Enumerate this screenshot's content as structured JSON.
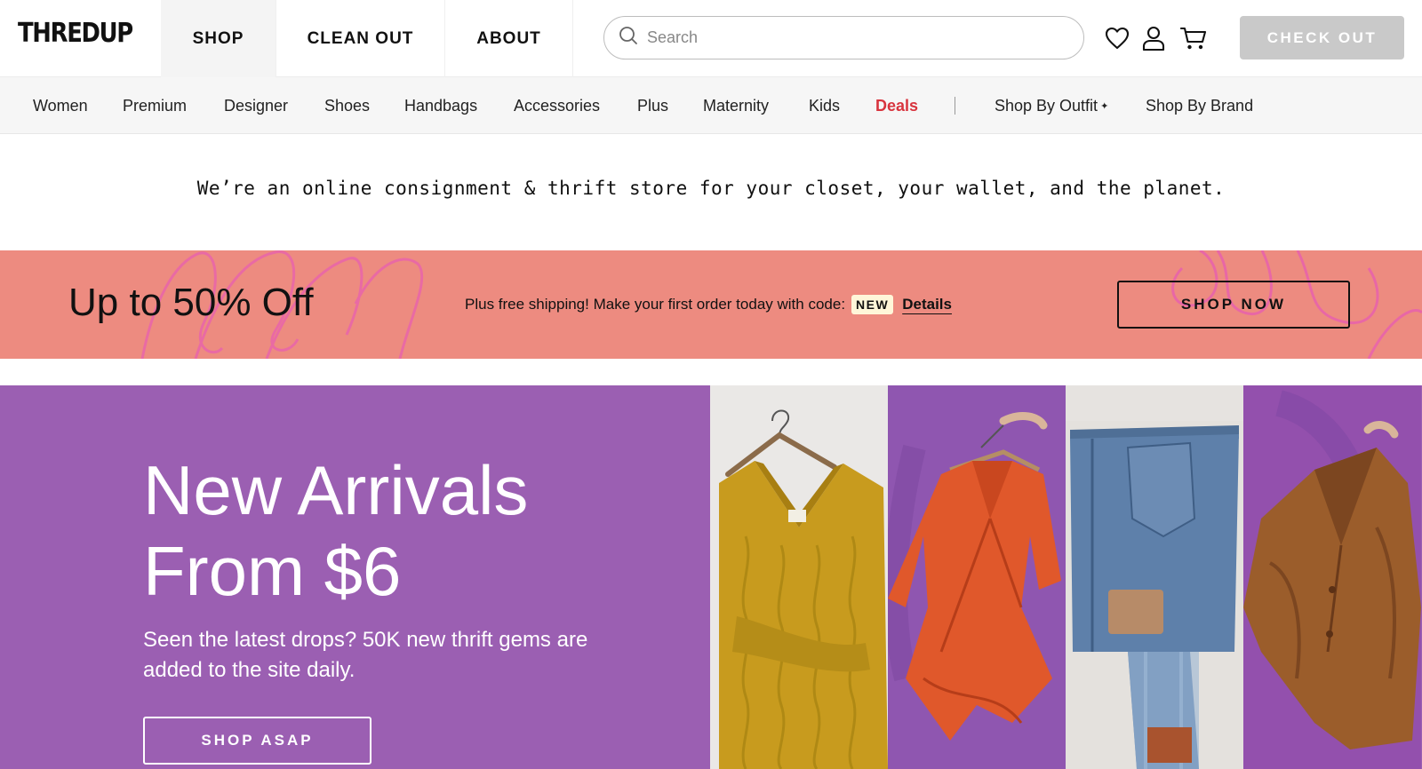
{
  "header": {
    "logo": "THREDUP",
    "nav": [
      {
        "label": "SHOP",
        "active": true
      },
      {
        "label": "CLEAN OUT",
        "active": false
      },
      {
        "label": "ABOUT",
        "active": false
      }
    ],
    "search_placeholder": "Search",
    "icons": [
      "search-icon",
      "heart-icon",
      "user-icon",
      "cart-icon"
    ],
    "checkout_label": "CHECK OUT"
  },
  "categories": [
    {
      "label": "Women"
    },
    {
      "label": "Premium"
    },
    {
      "label": "Designer"
    },
    {
      "label": "Shoes"
    },
    {
      "label": "Handbags"
    },
    {
      "label": "Accessories"
    },
    {
      "label": "Plus"
    },
    {
      "label": "Maternity"
    },
    {
      "label": "Kids"
    },
    {
      "label": "Deals",
      "highlight": true
    },
    {
      "label": "Shop By Outfit",
      "badge": "✦"
    },
    {
      "label": "Shop By Brand"
    }
  ],
  "tagline": "We’re an online consignment & thrift store for your closet, your wallet, and the planet.",
  "promo": {
    "title": "Up to 50% Off",
    "text": "Plus free shipping! Make your first order today with code:",
    "code": "NEW",
    "details": "Details",
    "button": "SHOP NOW",
    "color": "#ed8b80",
    "swirl_color": "#e85fb0"
  },
  "hero": {
    "title_line1": "New Arrivals",
    "title_line2": "From $6",
    "subtitle": "Seen the latest drops? 50K new thrift gems are added to the site daily.",
    "button": "SHOP ASAP",
    "color": "#9b5fb2",
    "images": [
      "mustard-cable-knit-sweater",
      "orange-wrap-dress",
      "folded-denim-jeans",
      "brown-leather-blazer"
    ]
  }
}
